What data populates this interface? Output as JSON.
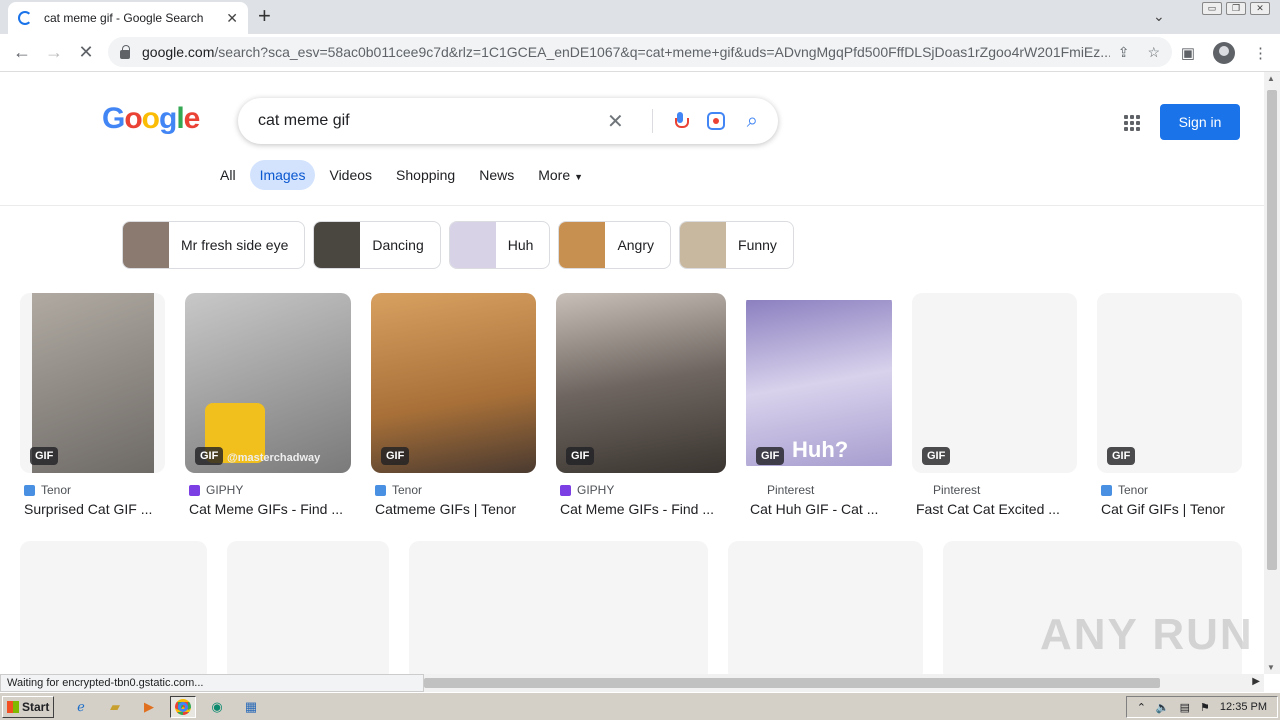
{
  "browser": {
    "tab_title": "cat meme gif - Google Search",
    "new_tab": "+",
    "url_domain": "google.com",
    "url_path": "/search?sca_esv=58ac0b011cee9c7d&rlz=1C1GCEA_enDE1067&q=cat+meme+gif&uds=ADvngMgqPfd500FffDLSjDoas1rZgoo4rW201FmiEz...",
    "status_text": "Waiting for encrypted-tbn0.gstatic.com..."
  },
  "google": {
    "logo": {
      "g1": "G",
      "o1": "o",
      "o2": "o",
      "g2": "g",
      "l": "l",
      "e": "e"
    },
    "query": "cat meme gif",
    "sign_in": "Sign in",
    "tabs": [
      "All",
      "Images",
      "Videos",
      "Shopping",
      "News",
      "More"
    ],
    "active_tab": "Images"
  },
  "chips": [
    {
      "label": "Mr fresh side eye",
      "color": "#8a7a70"
    },
    {
      "label": "Dancing",
      "color": "#4a4640"
    },
    {
      "label": "Huh",
      "color": "#d8d2e6"
    },
    {
      "label": "Angry",
      "color": "#c89050"
    },
    {
      "label": "Funny",
      "color": "#c8b8a0"
    }
  ],
  "results": [
    {
      "source": "Tenor",
      "caption": "Surprised Cat GIF ...",
      "badge": "GIF",
      "favicon": "#4a90e2",
      "bg": "#8a8580"
    },
    {
      "source": "GIPHY",
      "caption": "Cat Meme GIFs - Find ...",
      "badge": "GIF",
      "watermark": "@masterchadway",
      "favicon": "#7b3fe4",
      "bg": "#9a9a9a"
    },
    {
      "source": "Tenor",
      "caption": "Catmeme GIFs | Tenor",
      "badge": "GIF",
      "favicon": "#4a90e2",
      "bg": "#c98a4a"
    },
    {
      "source": "GIPHY",
      "caption": "Cat Meme GIFs - Find ...",
      "badge": "GIF",
      "favicon": "#7b3fe4",
      "bg": "#6e6560"
    },
    {
      "source": "Pinterest",
      "caption": "Cat Huh GIF - Cat ...",
      "badge": "GIF",
      "overlay": "Huh?",
      "favicon": "#ffffff",
      "bg": "#b8aee0"
    },
    {
      "source": "Pinterest",
      "caption": "Fast Cat Cat Excited ...",
      "badge": "GIF",
      "favicon": "#ffffff",
      "bg": "#f5f5f5"
    },
    {
      "source": "Tenor",
      "caption": "Cat Gif GIFs | Tenor",
      "badge": "GIF",
      "favicon": "#4a90e2",
      "bg": "#f5f5f5"
    }
  ],
  "watermark": "ANY RUN",
  "taskbar": {
    "start": "Start",
    "clock": "12:35 PM"
  }
}
